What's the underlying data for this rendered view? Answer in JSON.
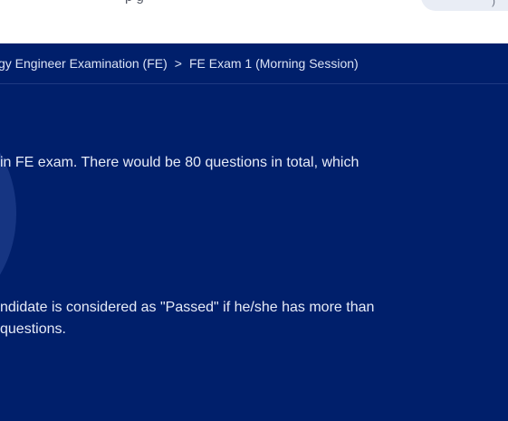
{
  "topbar": {
    "partial_text": "p      g",
    "pill_glyph": ")"
  },
  "breadcrumb": {
    "item_1": "gy Engineer Examination (FE)",
    "separator": ">",
    "item_2": "FE Exam 1 (Morning Session)"
  },
  "content": {
    "paragraph_1_line_1": "in FE exam. There would be 80 questions in total, which",
    "paragraph_2_line_1": "ndidate is considered as \"Passed\" if he/she has more than",
    "paragraph_2_line_2": "questions."
  },
  "colors": {
    "hero_background": "#001f6b",
    "text": "#e6ebf7"
  }
}
